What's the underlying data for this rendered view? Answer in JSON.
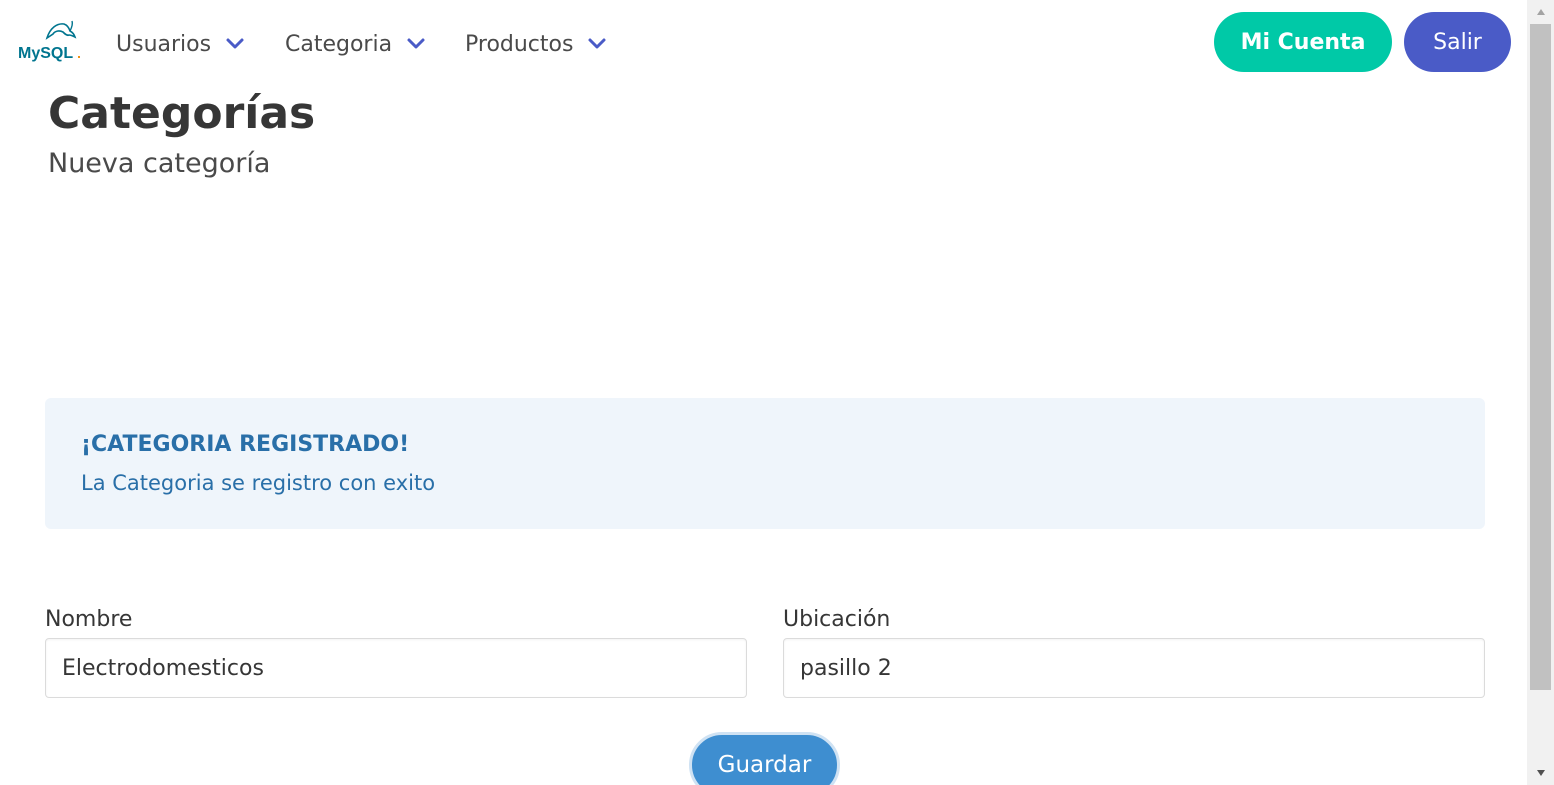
{
  "navbar": {
    "logo_text": "MySQL",
    "items": [
      {
        "label": "Usuarios"
      },
      {
        "label": "Categoria"
      },
      {
        "label": "Productos"
      }
    ],
    "account_button": "Mi Cuenta",
    "logout_button": "Salir"
  },
  "header": {
    "title": "Categorías",
    "subtitle": "Nueva categoría"
  },
  "notification": {
    "title": "¡CATEGORIA REGISTRADO!",
    "message": "La Categoria se registro con exito"
  },
  "form": {
    "nombre_label": "Nombre",
    "nombre_value": "Electrodomesticos",
    "ubicacion_label": "Ubicación",
    "ubicacion_value": "pasillo 2",
    "submit_label": "Guardar"
  },
  "colors": {
    "account_button": "#00c9a7",
    "logout_button": "#4a5bc7",
    "submit_button": "#3e8ed0",
    "notification_bg": "#eff5fb",
    "notification_text": "#296fa8",
    "nav_chevron": "#4a5bc7"
  }
}
